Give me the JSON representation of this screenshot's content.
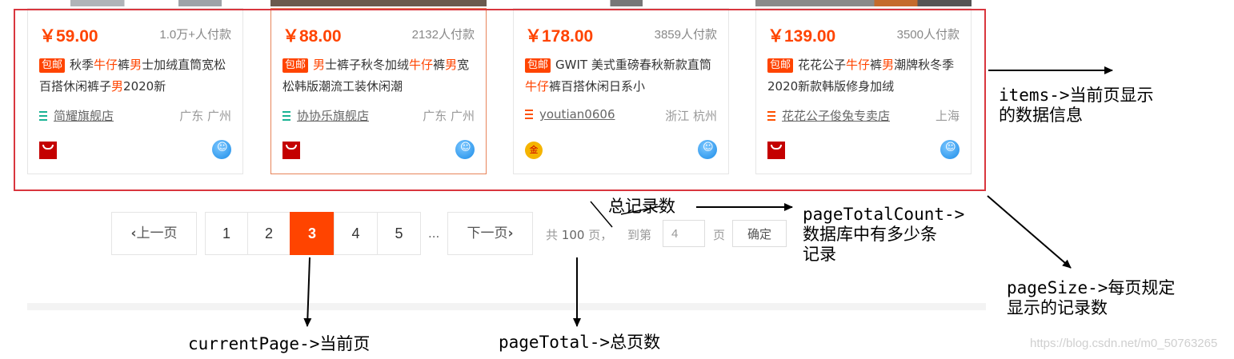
{
  "products": [
    {
      "price": "￥59.00",
      "paid": "1.0万+人付款",
      "badge": "包邮",
      "title_parts": [
        "秋季",
        "牛仔",
        "裤",
        "男",
        "士加绒直筒宽松百搭休闲裤子",
        "男",
        "2020新"
      ],
      "shop": "简耀旗舰店",
      "location": "广东 广州",
      "shop_icon": "shop-stripes-icon-green",
      "seller_icon": "tmall-icon"
    },
    {
      "price": "￥88.00",
      "paid": "2132人付款",
      "badge": "包邮",
      "title_parts": [
        "",
        "男",
        "士裤子秋冬加绒",
        "牛仔",
        "裤",
        "男",
        "宽松韩版潮流工装休闲潮"
      ],
      "shop": "协协乐旗舰店",
      "location": "广东 广州",
      "shop_icon": "shop-stripes-icon-green",
      "seller_icon": "tmall-icon"
    },
    {
      "price": "￥178.00",
      "paid": "3859人付款",
      "badge": "包邮",
      "title_parts": [
        "GWIT 美式重磅春秋新款直筒",
        "牛仔",
        "裤百搭休闲日系小",
        "",
        "",
        "",
        ""
      ],
      "shop": "youtian0606",
      "location": "浙江 杭州",
      "shop_icon": "shop-stripes-icon-orange",
      "seller_icon": "gold-seller-icon"
    },
    {
      "price": "￥139.00",
      "paid": "3500人付款",
      "badge": "包邮",
      "title_parts": [
        "花花公子",
        "牛仔",
        "裤",
        "男",
        "潮牌秋冬季2020新款韩版修身加绒",
        "",
        ""
      ],
      "shop": "花花公子俊兔专卖店",
      "location": "上海",
      "shop_icon": "shop-stripes-icon-orange",
      "seller_icon": "tmall-icon"
    }
  ],
  "pagination": {
    "prev": "上一页",
    "pages": [
      "1",
      "2",
      "3",
      "4",
      "5"
    ],
    "current": "3",
    "ellipsis": "...",
    "next": "下一页",
    "total_prefix": "共",
    "total_pages": "100",
    "total_suffix": "页，",
    "goto_prefix": "到第",
    "goto_value": "4",
    "goto_suffix": "页",
    "confirm": "确定"
  },
  "annotations": {
    "items": "items->当前页显示\n的数据信息",
    "total_records": "总记录数",
    "page_total_count": "pageTotalCount->\n数据库中有多少条\n记录",
    "page_size": "pageSize->每页规定\n显示的记录数",
    "current_page": "currentPage->当前页",
    "page_total": "pageTotal->总页数"
  },
  "watermark": "https://blog.csdn.net/m0_50763265",
  "colors": {
    "accent": "#ff4400",
    "annotation_box": "#d9363e"
  }
}
